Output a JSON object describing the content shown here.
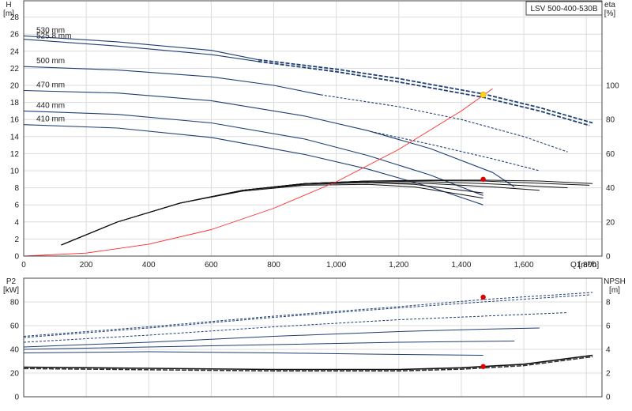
{
  "model_label": "LSV 500-400-530B",
  "chart_data": [
    {
      "type": "line",
      "panel": "head",
      "xlabel": "Q [m³/h]",
      "ylabel": "H\n[m]",
      "y2label": "eta\n[%]",
      "xlim": [
        0,
        1850
      ],
      "ylim": [
        0,
        30
      ],
      "y2lim": [
        0,
        150
      ],
      "xticks": [
        0,
        200,
        400,
        600,
        800,
        1000,
        1200,
        1400,
        1600,
        1800
      ],
      "xtick_labels": [
        "0",
        "200",
        "400",
        "600",
        "800",
        "1,000",
        "1,200",
        "1,400",
        "1,600",
        "1,800"
      ],
      "yticks": [
        0,
        2,
        4,
        6,
        8,
        10,
        12,
        14,
        16,
        18,
        20,
        22,
        24,
        26,
        28
      ],
      "y2ticks": [
        0,
        20,
        40,
        60,
        80,
        100
      ],
      "grid": true,
      "impeller_labels": [
        "530 mm",
        "525.8 mm",
        "500 mm",
        "470 mm",
        "440 mm",
        "410 mm"
      ],
      "head_curves": [
        {
          "label": "530 mm",
          "color": "#1f3f73",
          "solid": [
            [
              0,
              25.8
            ],
            [
              300,
              25.1
            ],
            [
              600,
              24.1
            ],
            [
              750,
              23.0
            ]
          ],
          "dashed": [
            [
              750,
              23.0
            ],
            [
              1000,
              21.9
            ],
            [
              1200,
              20.8
            ],
            [
              1470,
              19.0
            ],
            [
              1650,
              17.4
            ],
            [
              1820,
              15.6
            ]
          ]
        },
        {
          "label": "525.8 mm",
          "color": "#1f3f73",
          "solid": [
            [
              0,
              25.4
            ],
            [
              300,
              24.6
            ],
            [
              600,
              23.6
            ],
            [
              750,
              22.8
            ]
          ],
          "dashed": [
            [
              750,
              22.8
            ],
            [
              1000,
              21.6
            ],
            [
              1200,
              20.4
            ],
            [
              1470,
              18.6
            ],
            [
              1650,
              17.0
            ],
            [
              1810,
              15.3
            ]
          ]
        },
        {
          "label": "500 mm",
          "color": "#1f3f73",
          "solid": [
            [
              0,
              22.2
            ],
            [
              300,
              21.8
            ],
            [
              600,
              21.0
            ],
            [
              800,
              20.0
            ],
            [
              950,
              18.9
            ]
          ],
          "dashed": [
            [
              950,
              18.9
            ],
            [
              1200,
              17.5
            ],
            [
              1400,
              16.0
            ],
            [
              1600,
              14.0
            ],
            [
              1740,
              12.2
            ]
          ]
        },
        {
          "label": "470 mm",
          "color": "#1f3f73",
          "solid": [
            [
              0,
              19.4
            ],
            [
              300,
              19.1
            ],
            [
              600,
              18.2
            ],
            [
              900,
              16.4
            ],
            [
              1100,
              14.7
            ],
            [
              1300,
              12.6
            ],
            [
              1500,
              9.8
            ],
            [
              1570,
              8.1
            ]
          ],
          "dashed": [
            [
              1110,
              14.6
            ],
            [
              1300,
              13.1
            ],
            [
              1500,
              11.4
            ],
            [
              1650,
              10.0
            ]
          ]
        },
        {
          "label": "440 mm",
          "color": "#1f3f73",
          "solid": [
            [
              0,
              17.0
            ],
            [
              300,
              16.6
            ],
            [
              600,
              15.6
            ],
            [
              900,
              13.7
            ],
            [
              1100,
              11.8
            ],
            [
              1300,
              9.5
            ],
            [
              1470,
              7.1
            ]
          ],
          "dashed": []
        },
        {
          "label": "410 mm",
          "color": "#1f3f73",
          "solid": [
            [
              0,
              15.4
            ],
            [
              300,
              15.0
            ],
            [
              600,
              13.9
            ],
            [
              900,
              11.9
            ],
            [
              1100,
              10.2
            ],
            [
              1300,
              8.1
            ],
            [
              1470,
              6.0
            ]
          ],
          "dashed": []
        }
      ],
      "efficiency_curves": [
        {
          "label": "530 mm",
          "values_pct": [
            [
              120,
              6.5
            ],
            [
              300,
              20
            ],
            [
              500,
              31
            ],
            [
              700,
              38.5
            ],
            [
              900,
              42.5
            ],
            [
              1100,
              44
            ],
            [
              1300,
              44.5
            ],
            [
              1470,
              44.5
            ],
            [
              1650,
              44
            ],
            [
              1820,
              42.5
            ]
          ]
        },
        {
          "label": "525.8 mm",
          "values_pct": [
            [
              120,
              6.5
            ],
            [
              300,
              20
            ],
            [
              500,
              31
            ],
            [
              700,
              38.5
            ],
            [
              900,
              42.5
            ],
            [
              1100,
              44
            ],
            [
              1300,
              44.2
            ],
            [
              1470,
              44
            ],
            [
              1810,
              41.5
            ]
          ]
        },
        {
          "label": "500 mm",
          "values_pct": [
            [
              120,
              6.5
            ],
            [
              300,
              20
            ],
            [
              500,
              31
            ],
            [
              700,
              38.5
            ],
            [
              900,
              42.5
            ],
            [
              1100,
              44
            ],
            [
              1300,
              43.5
            ],
            [
              1470,
              42.5
            ],
            [
              1740,
              40
            ]
          ]
        },
        {
          "label": "470 mm",
          "values_pct": [
            [
              120,
              6.5
            ],
            [
              300,
              20
            ],
            [
              500,
              31
            ],
            [
              700,
              38.5
            ],
            [
              900,
              42.5
            ],
            [
              1100,
              43.5
            ],
            [
              1300,
              42.5
            ],
            [
              1500,
              40.5
            ],
            [
              1650,
              38.5
            ]
          ]
        },
        {
          "label": "440 mm",
          "values_pct": [
            [
              120,
              6.5
            ],
            [
              300,
              20
            ],
            [
              500,
              31
            ],
            [
              700,
              38.5
            ],
            [
              900,
              42
            ],
            [
              1100,
              43
            ],
            [
              1250,
              42
            ],
            [
              1470,
              37
            ]
          ]
        },
        {
          "label": "410 mm",
          "values_pct": [
            [
              120,
              6.5
            ],
            [
              300,
              20
            ],
            [
              500,
              31
            ],
            [
              700,
              38
            ],
            [
              900,
              41.5
            ],
            [
              1100,
              42
            ],
            [
              1250,
              40.5
            ],
            [
              1470,
              34
            ]
          ]
        }
      ],
      "system_curve": {
        "color": "#ff2a2a",
        "points": [
          [
            0,
            0
          ],
          [
            200,
            0.35
          ],
          [
            400,
            1.4
          ],
          [
            600,
            3.1
          ],
          [
            800,
            5.6
          ],
          [
            1000,
            8.7
          ],
          [
            1200,
            12.5
          ],
          [
            1400,
            17.0
          ],
          [
            1500,
            19.6
          ]
        ]
      },
      "duty_point": {
        "q": 1470,
        "h": 18.9,
        "color": "#ffd21a"
      },
      "efficiency_point": {
        "q": 1470,
        "eta_pct": 45,
        "color": "#e00000"
      }
    },
    {
      "type": "line",
      "panel": "power_npsh",
      "xlim": [
        0,
        1850
      ],
      "ylabel": "P2\n[kW]",
      "y2label": "NPSH\n[m]",
      "ylim": [
        0,
        100
      ],
      "y2lim": [
        0,
        10
      ],
      "yticks": [
        0,
        20,
        40,
        60,
        80
      ],
      "y2ticks": [
        0,
        2,
        4,
        6,
        8
      ],
      "grid": true,
      "power_curves": [
        {
          "label": "530 mm",
          "values": [
            [
              0,
              51
            ],
            [
              400,
              59
            ],
            [
              800,
              68
            ],
            [
              1200,
              76
            ],
            [
              1470,
              82
            ],
            [
              1820,
              88
            ]
          ]
        },
        {
          "label": "525.8 mm",
          "values": [
            [
              0,
              50
            ],
            [
              400,
              58
            ],
            [
              800,
              67
            ],
            [
              1200,
              75
            ],
            [
              1470,
              80
            ],
            [
              1810,
              86
            ]
          ]
        },
        {
          "label": "500 mm",
          "values": [
            [
              0,
              46
            ],
            [
              400,
              52
            ],
            [
              800,
              59
            ],
            [
              1200,
              65
            ],
            [
              1470,
              68
            ],
            [
              1740,
              71
            ]
          ]
        },
        {
          "label": "470 mm",
          "values": [
            [
              0,
              42
            ],
            [
              400,
              46
            ],
            [
              800,
              51
            ],
            [
              1200,
              55
            ],
            [
              1470,
              57
            ],
            [
              1650,
              58
            ]
          ]
        },
        {
          "label": "440 mm",
          "values": [
            [
              0,
              40
            ],
            [
              400,
              42
            ],
            [
              800,
              44
            ],
            [
              1200,
              46
            ],
            [
              1570,
              47
            ]
          ]
        },
        {
          "label": "410 mm",
          "values": [
            [
              0,
              37
            ],
            [
              400,
              38
            ],
            [
              800,
              37
            ],
            [
              1100,
              36
            ],
            [
              1470,
              35
            ]
          ]
        }
      ],
      "npsh_curve": {
        "values_m": [
          [
            0,
            2.5
          ],
          [
            400,
            2.4
          ],
          [
            800,
            2.3
          ],
          [
            1000,
            2.3
          ],
          [
            1200,
            2.3
          ],
          [
            1400,
            2.45
          ],
          [
            1600,
            2.75
          ],
          [
            1820,
            3.5
          ]
        ]
      },
      "power_point": {
        "q": 1470,
        "p2": 84
      },
      "npsh_point": {
        "q": 1470,
        "npsh": 2.55
      }
    }
  ]
}
